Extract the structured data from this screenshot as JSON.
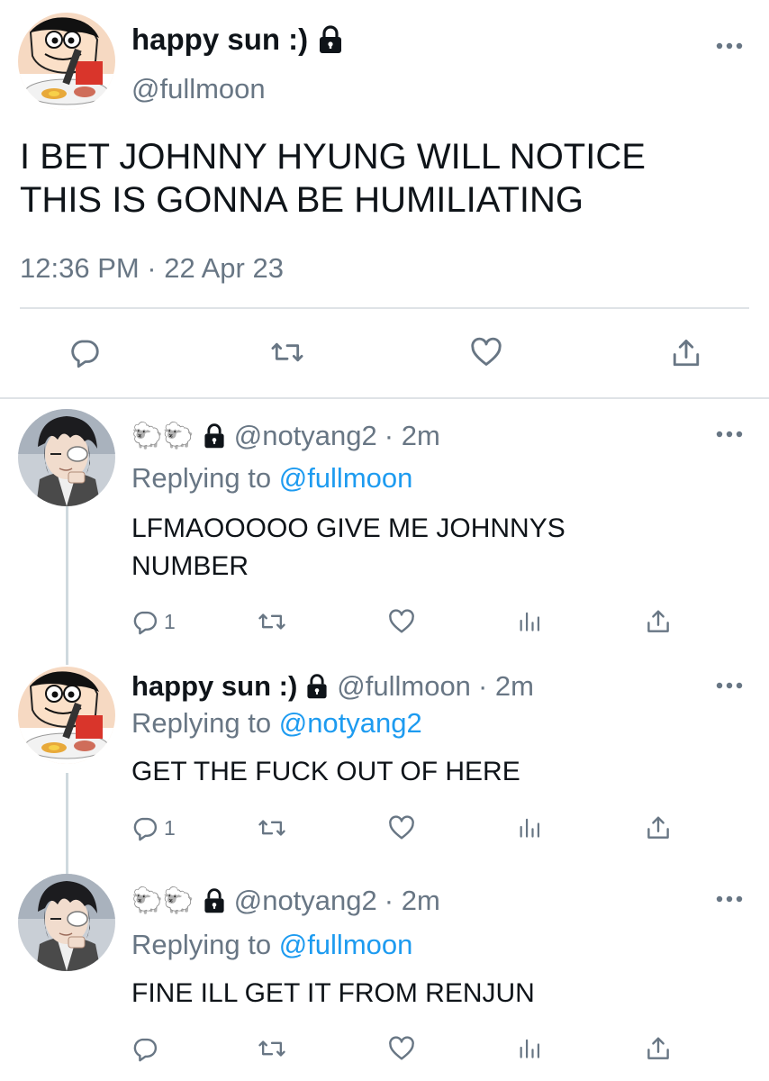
{
  "main_tweet": {
    "display_name": "happy sun :)",
    "handle": "@fullmoon",
    "text_line1": "I BET JOHNNY HYUNG WILL NOTICE",
    "text_line2": "THIS IS GONNA BE HUMILIATING",
    "timestamp": "12:36 PM · 22 Apr 23"
  },
  "replies": [
    {
      "display_name": "🐑🐑",
      "handle": "@notyang2",
      "time": "· 2m",
      "replying_prefix": "Replying to",
      "replying_to": "@fullmoon",
      "text_line1": "LFMAOOOOO GIVE ME JOHNNYS",
      "text_line2": "NUMBER",
      "reply_count": "1"
    },
    {
      "display_name": "happy sun :)",
      "handle": "@fullmoon",
      "time": "· 2m",
      "replying_prefix": "Replying to",
      "replying_to": "@notyang2",
      "text_line1": "GET THE FUCK OUT OF HERE",
      "reply_count": "1"
    },
    {
      "display_name": "🐑🐑",
      "handle": "@notyang2",
      "time": "· 2m",
      "replying_prefix": "Replying to",
      "replying_to": "@fullmoon",
      "text_line1": "FINE ILL GET IT FROM RENJUN",
      "reply_count": ""
    }
  ],
  "icons": {
    "lock": "lock-icon",
    "reply": "reply-icon",
    "retweet": "retweet-icon",
    "like": "heart-icon",
    "views": "analytics-icon",
    "share": "share-icon",
    "more": "more-icon"
  },
  "colors": {
    "accent": "#1d9bf0",
    "muted": "#687684",
    "divider": "#dfe3e6"
  }
}
